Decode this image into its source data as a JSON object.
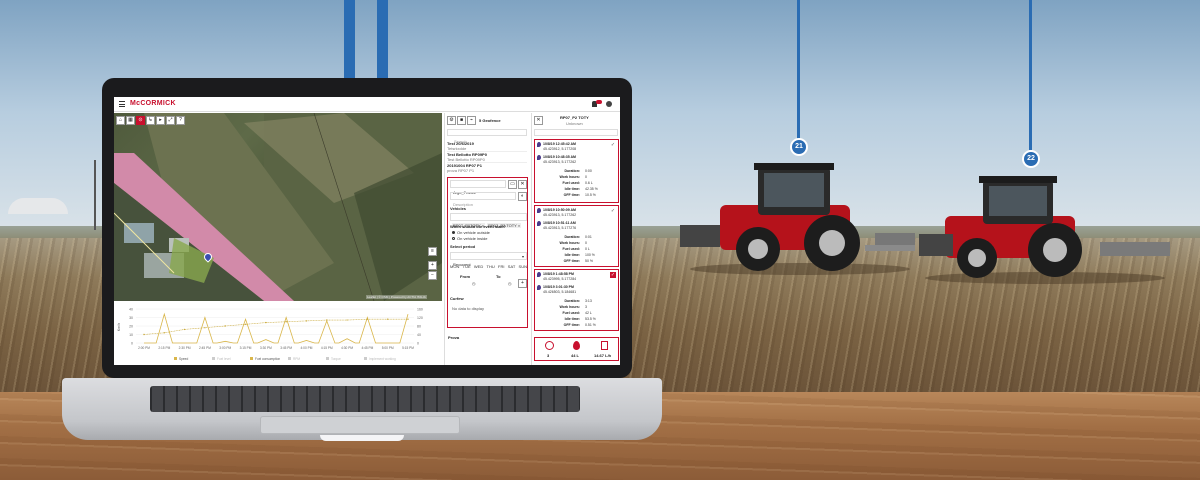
{
  "colors": {
    "brand": "#c8102e",
    "pole": "#2a6cb3",
    "chart_line": "#d9b64a"
  },
  "markers": [
    "21",
    "22"
  ],
  "app": {
    "brand": "McCORMICK",
    "map_label": "Leaflet | © OSM | Powered by ACTIA ITALIA",
    "geofence": {
      "title": "5 Geofence",
      "search_placeholder": "Search",
      "items": [
        {
          "name": "Test 20/6/2019",
          "sub": "Tetsrkxdde"
        },
        {
          "name": "Test Bellotto RP09P0",
          "sub": "Test Bellotto RP09P0"
        },
        {
          "name": "20191004 RP07 P1",
          "sub": "prova RP07 P1"
        }
      ],
      "name_value": "Argo_France",
      "description_placeholder": "Description",
      "vehicles_label": "Vehicles",
      "vehicle_chips": [
        "RP07_P0TOTY ×",
        "RP07_P2 TOTY ×"
      ],
      "event_question": "When should the event start?",
      "option_outside": "On vehicle outside",
      "option_inside": "On vehicle inside",
      "period_label": "Select period",
      "period_value": "Recurrent",
      "days": [
        "MON",
        "TUE",
        "WED",
        "THU",
        "FRI",
        "SAT",
        "SUN"
      ],
      "from_label": "From",
      "to_label": "To",
      "curfew_label": "Curfew",
      "curfew_empty": "No data to display",
      "footer": "Prova"
    },
    "vehicle_panel": {
      "title": "RP07_P2 TOTY",
      "subtitle": "Unknown",
      "search_placeholder": "Search",
      "trips": [
        {
          "start": "10/8/19 12:45:42 AM",
          "start_coord": "45.423912, 5.177208",
          "end": "10/8/19 10:48:35 AM",
          "end_coord": "45.423913, 5.177262",
          "duration": "0:00",
          "work_hours": "0",
          "fuel": "0.6 L",
          "idle": "42.35 %",
          "off": "10.5 %"
        },
        {
          "start": "10/8/19 10:50:09 AM",
          "start_coord": "45.423913, 5.177262",
          "end": "10/8/19 10:51:11 AM",
          "end_coord": "45.423913, 5.177276",
          "duration": "0:01",
          "work_hours": "0",
          "fuel": "0 L",
          "idle": "100 %",
          "off": "50 %"
        },
        {
          "start": "10/8/19 1:48:58 PM",
          "start_coord": "45.423995, 5.177284",
          "end": "10/8/19 3:01:30 PM",
          "end_coord": "45.426503, 5.184681",
          "duration": "3:13",
          "work_hours": "3",
          "fuel": "42 L",
          "idle": "53.5 %",
          "off": "0.51 %"
        }
      ],
      "labels": {
        "duration": "Duration:",
        "work_hours": "Work hours:",
        "fuel": "Fuel used:",
        "idle": "Idle time:",
        "off": "OFF time:"
      },
      "totals": [
        "3",
        "44 L",
        "14.67 L/h"
      ]
    },
    "chart": {
      "ylabel": "Km/h",
      "yticks": [
        "40",
        "30",
        "20",
        "10",
        "0"
      ],
      "y2ticks": [
        "160",
        "120",
        "80",
        "40",
        "0"
      ],
      "xticks": [
        "2:00 PM",
        "2:15 PM",
        "2:30 PM",
        "2:45 PM",
        "3:00 PM",
        "3:15 PM",
        "3:30 PM",
        "3:45 PM",
        "4:00 PM",
        "4:15 PM",
        "4:30 PM",
        "4:45 PM",
        "5:00 PM",
        "5:15 PM"
      ],
      "legend": [
        "Speed",
        "Fuel level",
        "Fuel consumption",
        "RPM",
        "Torque",
        "Implement working"
      ]
    }
  },
  "chart_data": {
    "type": "line",
    "xlabel": "",
    "ylabel": "Km/h",
    "x": [
      "2:00 PM",
      "2:15 PM",
      "2:30 PM",
      "2:45 PM",
      "3:00 PM",
      "3:15 PM",
      "3:30 PM",
      "3:45 PM",
      "4:00 PM",
      "4:15 PM",
      "4:30 PM",
      "4:45 PM",
      "5:00 PM",
      "5:15 PM"
    ],
    "series": [
      {
        "name": "Speed",
        "values": [
          0,
          34,
          0,
          30,
          2,
          28,
          4,
          30,
          3,
          26,
          5,
          30,
          0,
          34
        ]
      },
      {
        "name": "Fuel consumption",
        "values": [
          10,
          12,
          16,
          18,
          20,
          22,
          24,
          25,
          26,
          27,
          27,
          28,
          28,
          28
        ]
      }
    ]
  }
}
